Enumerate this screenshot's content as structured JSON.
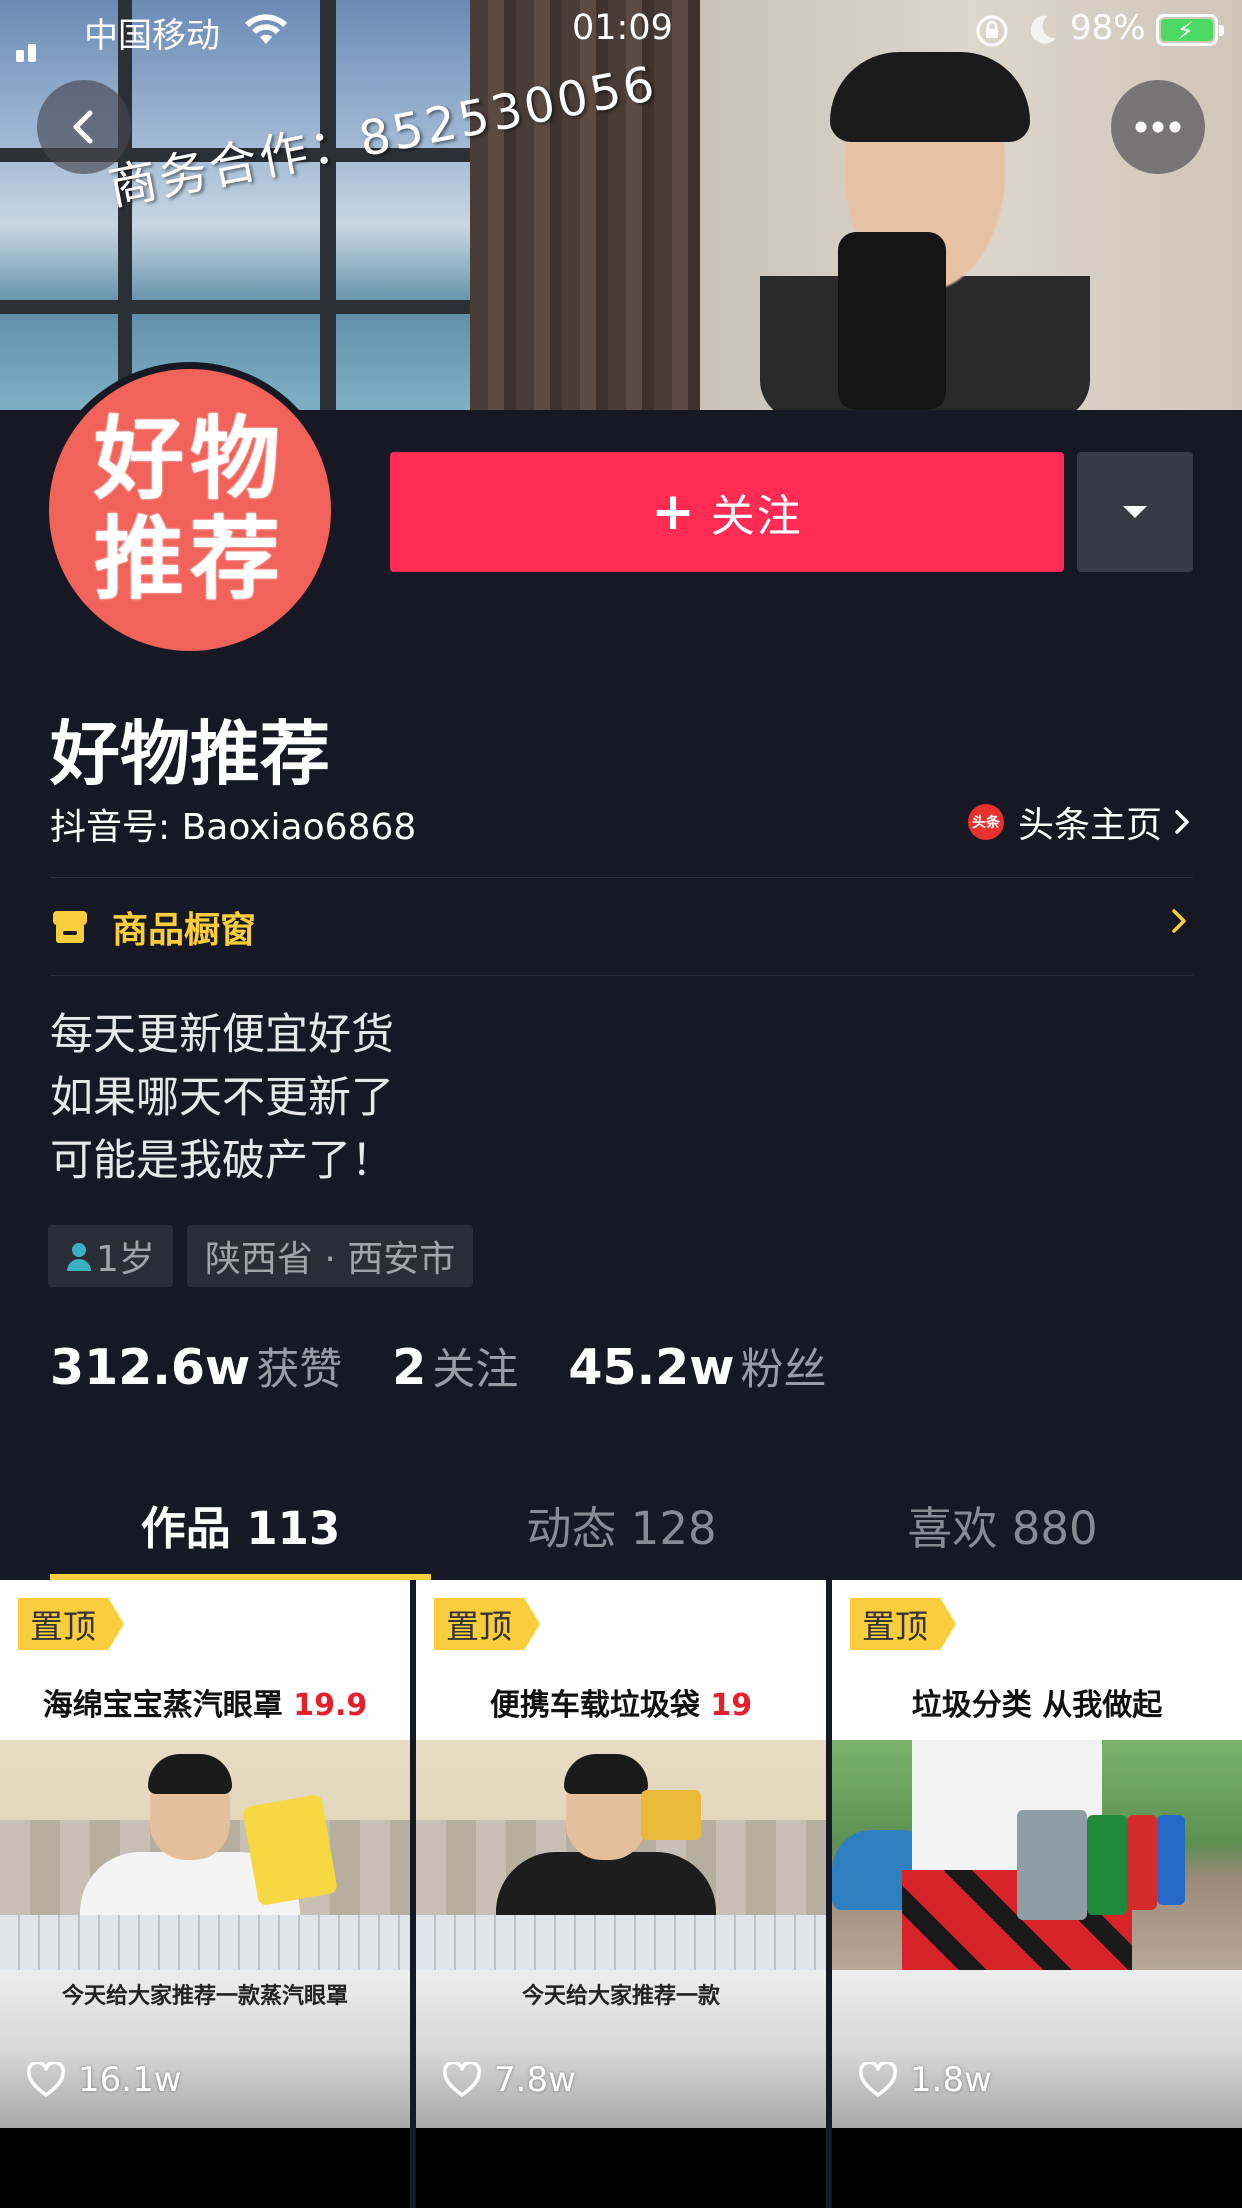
{
  "status_bar": {
    "carrier": "中国移动",
    "time": "01:09",
    "battery_percent": "98%"
  },
  "cover": {
    "watermark_text": "商务合作：852530056"
  },
  "avatar": {
    "line1": "好物",
    "line2": "推荐",
    "bg_color": "#f0625a"
  },
  "actions": {
    "follow_plus": "+",
    "follow_label": "关注",
    "follow_color": "#fe2c55"
  },
  "profile": {
    "nickname": "好物推荐",
    "douyin_id": "抖音号: Baoxiao6868",
    "toutiao_icon_text": "头条",
    "toutiao_label": "头条主页",
    "shop_label": "商品橱窗",
    "bio_lines": [
      "每天更新便宜好货",
      "如果哪天不更新了",
      "可能是我破产了！"
    ],
    "tags": {
      "age": "1岁",
      "location": "陕西省 · 西安市"
    }
  },
  "stats": {
    "likes_num": "312.6w",
    "likes_label": "获赞",
    "following_num": "2",
    "following_label": "关注",
    "fans_num": "45.2w",
    "fans_label": "粉丝"
  },
  "tabs": [
    {
      "label": "作品 113",
      "active": true
    },
    {
      "label": "动态 128",
      "active": false
    },
    {
      "label": "喜欢 880",
      "active": false
    }
  ],
  "videos": [
    {
      "pin": "置顶",
      "title": "海绵宝宝蒸汽眼罩",
      "price": "19.9",
      "caption": "今天给大家推荐一款蒸汽眼罩",
      "likes": "16.1w"
    },
    {
      "pin": "置顶",
      "title": "便携车载垃圾袋",
      "price": "19",
      "caption": "今天给大家推荐一款",
      "likes": "7.8w"
    },
    {
      "pin": "置顶",
      "title": "垃圾分类  从我做起",
      "price": "",
      "caption": "",
      "likes": "1.8w"
    }
  ],
  "colors": {
    "background": "#161823",
    "accent_yellow": "#facd3c",
    "follow_red": "#fe2c55"
  },
  "icons": [
    "back-icon",
    "more-icon",
    "dropdown-icon",
    "shop-icon",
    "chevron-right-icon",
    "heart-icon",
    "wifi-icon",
    "person-icon"
  ]
}
